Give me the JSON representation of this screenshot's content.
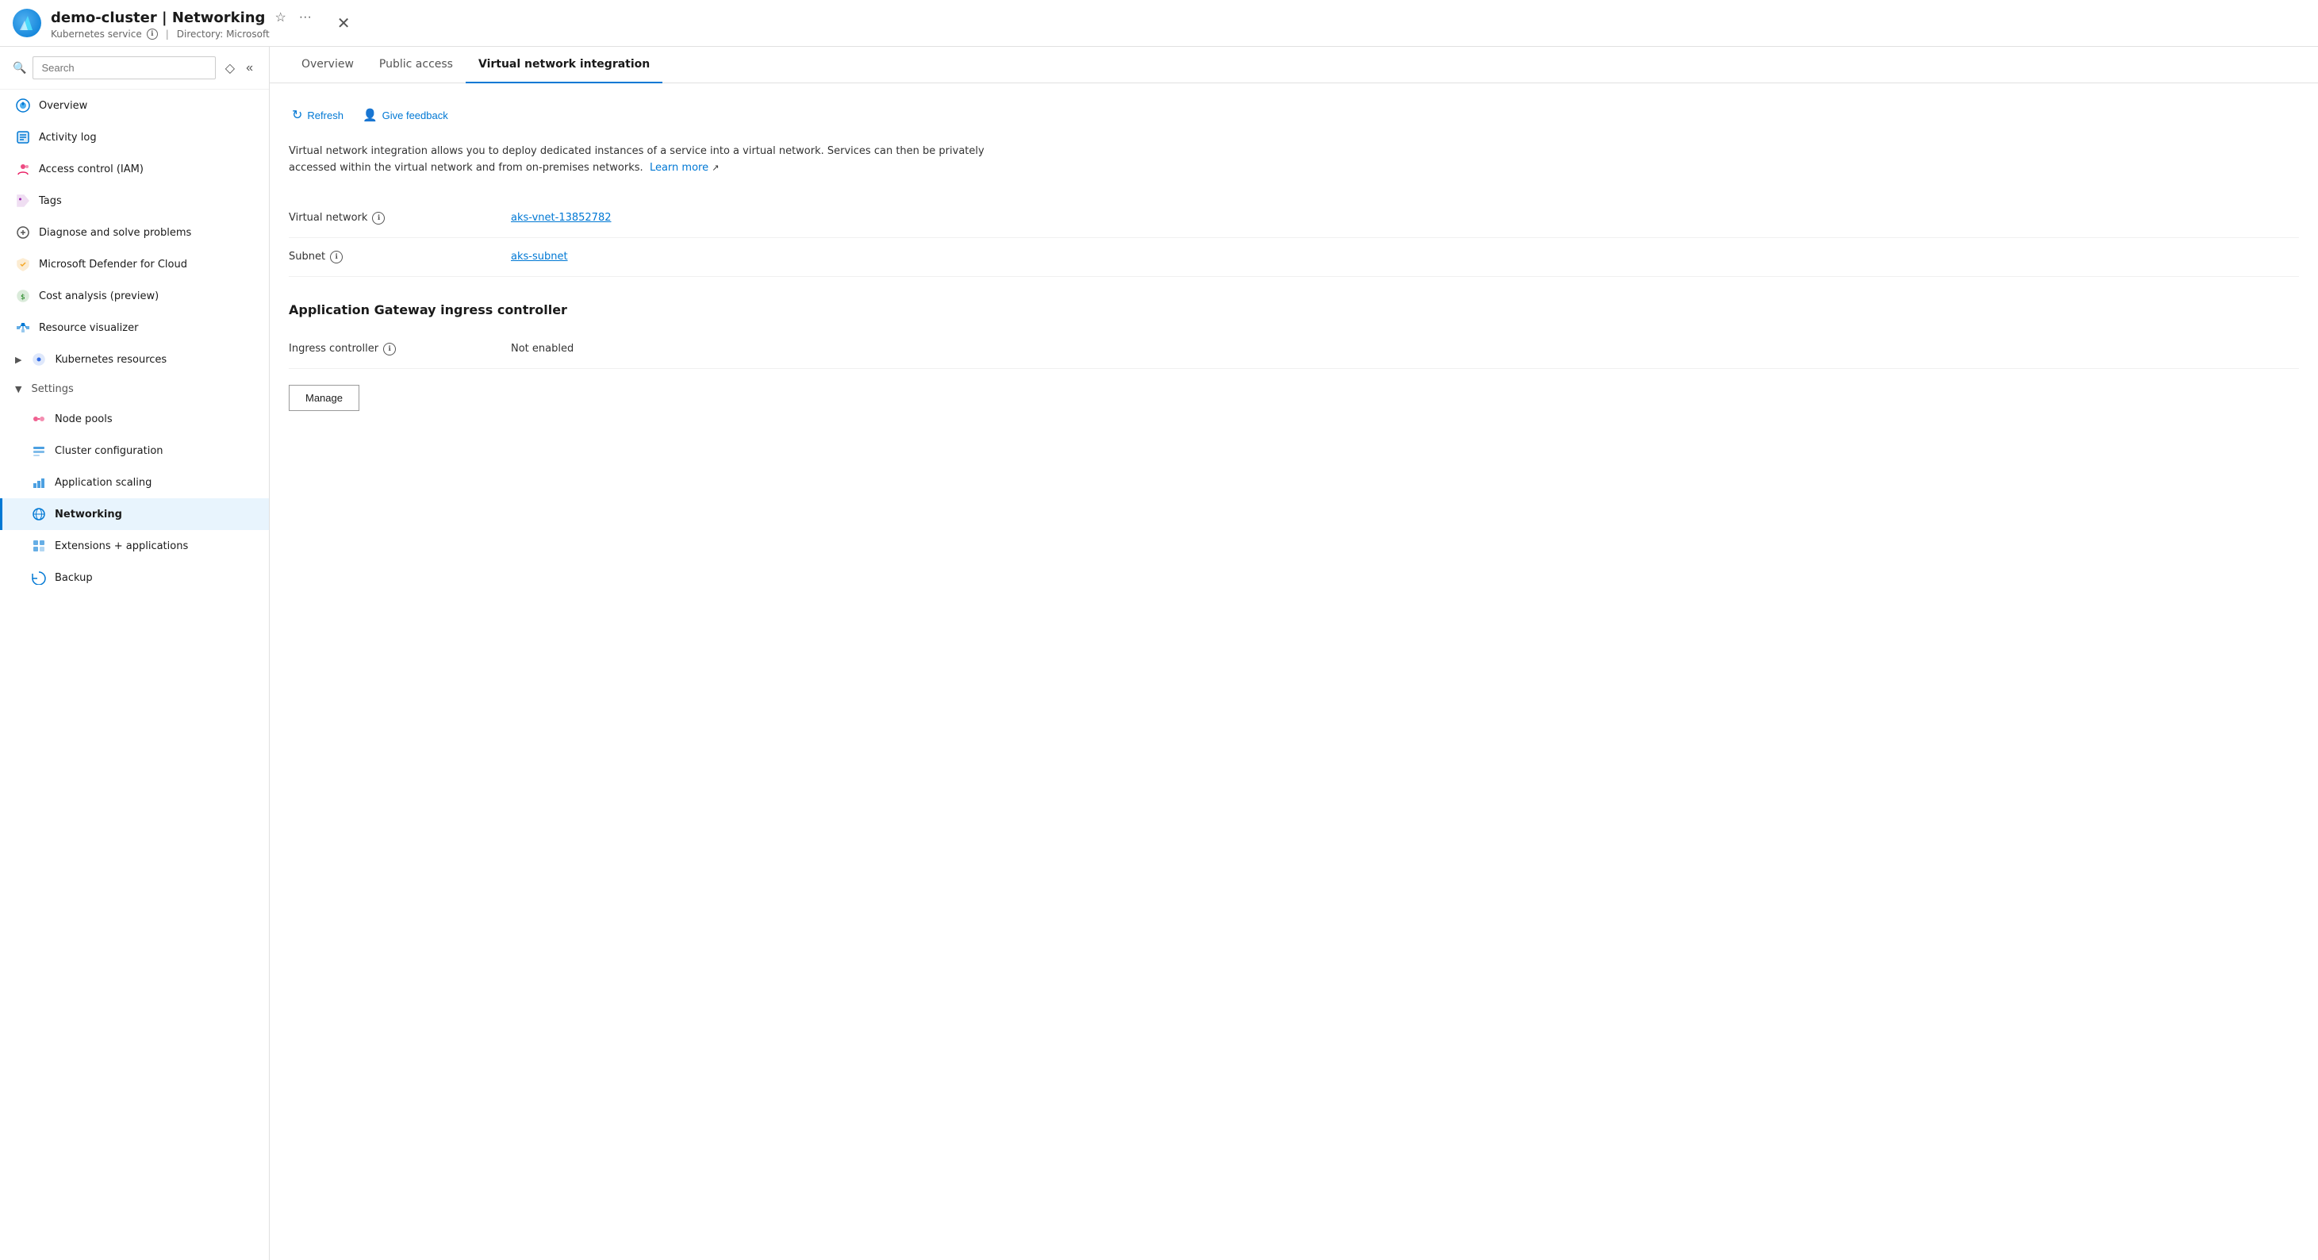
{
  "app": {
    "title": "demo-cluster | Networking",
    "service_type": "Kubernetes service",
    "info_icon_label": "ℹ",
    "directory_label": "Directory: Microsoft",
    "star_icon": "☆",
    "ellipsis_icon": "···",
    "close_icon": "✕"
  },
  "sidebar": {
    "search_placeholder": "Search",
    "items": [
      {
        "id": "overview",
        "label": "Overview",
        "icon": "overview",
        "active": false,
        "indent": false
      },
      {
        "id": "activity-log",
        "label": "Activity log",
        "icon": "activity",
        "active": false,
        "indent": false
      },
      {
        "id": "iam",
        "label": "Access control (IAM)",
        "icon": "iam",
        "active": false,
        "indent": false
      },
      {
        "id": "tags",
        "label": "Tags",
        "icon": "tags",
        "active": false,
        "indent": false
      },
      {
        "id": "diagnose",
        "label": "Diagnose and solve problems",
        "icon": "diagnose",
        "active": false,
        "indent": false
      },
      {
        "id": "defender",
        "label": "Microsoft Defender for Cloud",
        "icon": "defender",
        "active": false,
        "indent": false
      },
      {
        "id": "cost",
        "label": "Cost analysis (preview)",
        "icon": "cost",
        "active": false,
        "indent": false
      },
      {
        "id": "resource",
        "label": "Resource visualizer",
        "icon": "resource",
        "active": false,
        "indent": false
      },
      {
        "id": "kubernetes",
        "label": "Kubernetes resources",
        "icon": "kubernetes",
        "active": false,
        "indent": false,
        "expandable": true
      },
      {
        "id": "settings",
        "label": "Settings",
        "icon": "",
        "active": false,
        "indent": false,
        "collapsible": true,
        "expanded": true
      },
      {
        "id": "node-pools",
        "label": "Node pools",
        "icon": "node",
        "active": false,
        "indent": true
      },
      {
        "id": "cluster-config",
        "label": "Cluster configuration",
        "icon": "cluster",
        "active": false,
        "indent": true
      },
      {
        "id": "app-scaling",
        "label": "Application scaling",
        "icon": "scaling",
        "active": false,
        "indent": true
      },
      {
        "id": "networking",
        "label": "Networking",
        "icon": "networking",
        "active": true,
        "indent": true
      },
      {
        "id": "extensions",
        "label": "Extensions + applications",
        "icon": "extensions",
        "active": false,
        "indent": true
      },
      {
        "id": "backup",
        "label": "Backup",
        "icon": "backup",
        "active": false,
        "indent": true
      }
    ]
  },
  "tabs": [
    {
      "id": "overview",
      "label": "Overview",
      "active": false
    },
    {
      "id": "public-access",
      "label": "Public access",
      "active": false
    },
    {
      "id": "vnet-integration",
      "label": "Virtual network integration",
      "active": true
    }
  ],
  "actions": {
    "refresh": "Refresh",
    "give_feedback": "Give feedback"
  },
  "content": {
    "description": "Virtual network integration allows you to deploy dedicated instances of a service into a virtual network. Services can then be privately accessed within the virtual network and from on-premises networks.",
    "learn_more": "Learn more",
    "virtual_network_label": "Virtual network",
    "virtual_network_value": "aks-vnet-13852782",
    "subnet_label": "Subnet",
    "subnet_value": "aks-subnet",
    "gateway_section": "Application Gateway ingress controller",
    "ingress_controller_label": "Ingress controller",
    "ingress_controller_value": "Not enabled",
    "manage_button": "Manage"
  }
}
